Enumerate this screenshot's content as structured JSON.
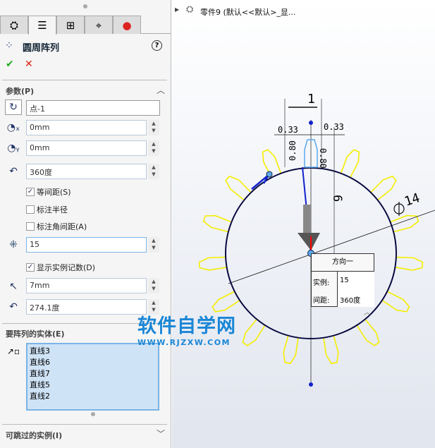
{
  "panel": {
    "title": "圆周阵列",
    "ok": "✔",
    "cancel": "✕",
    "help": "?",
    "params_section": "参数(P)",
    "axis_value": "点-1",
    "x_value": "0mm",
    "y_value": "0mm",
    "angle_value": "360度",
    "equal_spacing": "等间距(S)",
    "dim_radius": "标注半径",
    "dim_angle": "标注角间距(A)",
    "count_value": "15",
    "show_count": "显示实例记数(D)",
    "radius_value": "7mm",
    "angle2_value": "274.1度",
    "entities_section": "要阵列的实体(E)",
    "entities": [
      "直线3",
      "直线6",
      "直线7",
      "直线5",
      "直线2"
    ],
    "skip_section": "可跳过的实例(I)"
  },
  "tree": {
    "item": "零件9  (默认<<默认>_显..."
  },
  "callout": {
    "title": "方向一",
    "count_label": "实例:",
    "count": "15",
    "spacing_label": "间距:",
    "spacing": "360度"
  },
  "dims": {
    "width": "1",
    "left": "0.33",
    "right": "0.33",
    "h1": "0.80",
    "h2": "0.80",
    "height": "6",
    "diameter": "14"
  },
  "watermark": {
    "cn": "软件自学网",
    "url": "WWW.RJZXW.COM"
  }
}
